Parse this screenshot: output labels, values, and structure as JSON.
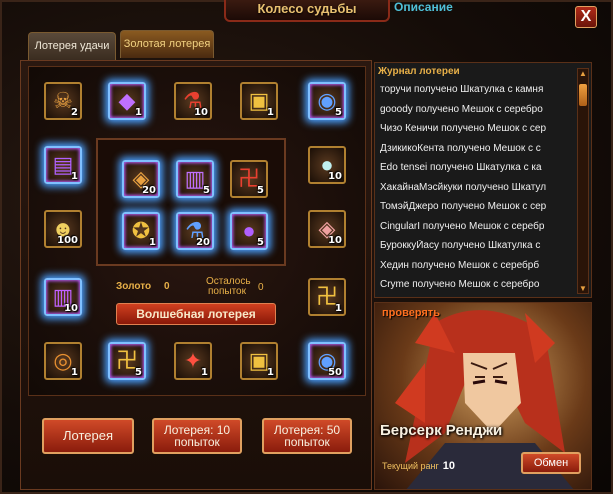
{
  "window": {
    "title": "Колесо судьбы",
    "description_link": "Описание",
    "close_label": "X"
  },
  "tabs": [
    {
      "label": "Лотерея удачи",
      "active": true
    },
    {
      "label": "Золотая лотерея",
      "active": false
    }
  ],
  "outer_slots": [
    {
      "icon": "treasure-chest-skull-icon",
      "glyph": "☠",
      "count": "2"
    },
    {
      "icon": "purple-crystal-icon",
      "glyph": "◆",
      "count": "1"
    },
    {
      "icon": "red-potion-icon",
      "glyph": "⚗",
      "count": "10"
    },
    {
      "icon": "gold-chest-icon",
      "glyph": "▣",
      "count": "1"
    },
    {
      "icon": "blue-flame-orb-icon",
      "glyph": "◉",
      "count": "5"
    },
    {
      "icon": "purple-gift-box-icon",
      "glyph": "▤",
      "count": "1"
    },
    {
      "icon": "white-orb-icon",
      "glyph": "●",
      "count": "10"
    },
    {
      "icon": "gold-skull-icon",
      "glyph": "☻",
      "count": "100"
    },
    {
      "icon": "pink-crystal-icon",
      "glyph": "◈",
      "count": "10"
    },
    {
      "icon": "purple-chest-icon",
      "glyph": "▥",
      "count": "10"
    },
    {
      "icon": "gold-rune-scroll-icon",
      "glyph": "卍",
      "count": "1"
    },
    {
      "icon": "spiral-coin-icon",
      "glyph": "◎",
      "count": "1"
    },
    {
      "icon": "gold-rune-scroll-icon",
      "glyph": "卍",
      "count": "5"
    },
    {
      "icon": "red-crystal-icon",
      "glyph": "✦",
      "count": "1"
    },
    {
      "icon": "gold-chest-icon",
      "glyph": "▣",
      "count": "1"
    },
    {
      "icon": "blue-flame-orb-icon",
      "glyph": "◉",
      "count": "50"
    }
  ],
  "inner_slots": [
    {
      "icon": "pink-crystal-icon",
      "glyph": "◈",
      "count": "20"
    },
    {
      "icon": "purple-chest-icon",
      "glyph": "▥",
      "count": "5"
    },
    {
      "icon": "gold-rune-scroll-icon",
      "glyph": "卍",
      "count": "5"
    },
    {
      "icon": "green-emblem-icon",
      "glyph": "✪",
      "count": "1"
    },
    {
      "icon": "red-potion-icon",
      "glyph": "⚗",
      "count": "20"
    },
    {
      "icon": "white-orb-icon",
      "glyph": "●",
      "count": "5"
    }
  ],
  "info": {
    "gold_label": "Золото",
    "gold_value": "0",
    "remaining_label_1": "Осталось",
    "remaining_label_2": "попыток",
    "remaining_value": "0"
  },
  "magic_lottery_label": "Волшебная лотерея",
  "actions": {
    "lottery": "Лотерея",
    "lottery10_line1": "Лотерея: 10",
    "lottery10_line2": "попыток",
    "lottery50_line1": "Лотерея: 50",
    "lottery50_line2": "попыток"
  },
  "log": {
    "title": "Журнал лотереи",
    "lines": [
      "торучи получено Шкатулка с камня",
      "gooody получено Мешок с серебро",
      "Чизо Кеничи  получено Мешок с сер",
      "ДзикикоКента  получено Мешок с с",
      "Edo tensei получено Шкатулка с ка",
      "ХакайнаМэсйкуки  получено Шкатул",
      "ТомэйДжеро  получено Мешок с сер",
      "CingularI  получено Мешок с серебр",
      "БуроккуЙасу  получено Шкатулка с",
      "Хедин  получено Мешок с серебрб",
      "Cryme получено Мешок с серебро"
    ]
  },
  "hero": {
    "check_label": "проверять",
    "name": "Берсерк Ренджи",
    "rank_label": "Текущий ранг",
    "rank_value": "10",
    "exchange_label": "Обмен"
  },
  "colors": {
    "accent_red": "#c8341c",
    "gold": "#e8b048",
    "glow_blue": "#4aa0ff"
  }
}
